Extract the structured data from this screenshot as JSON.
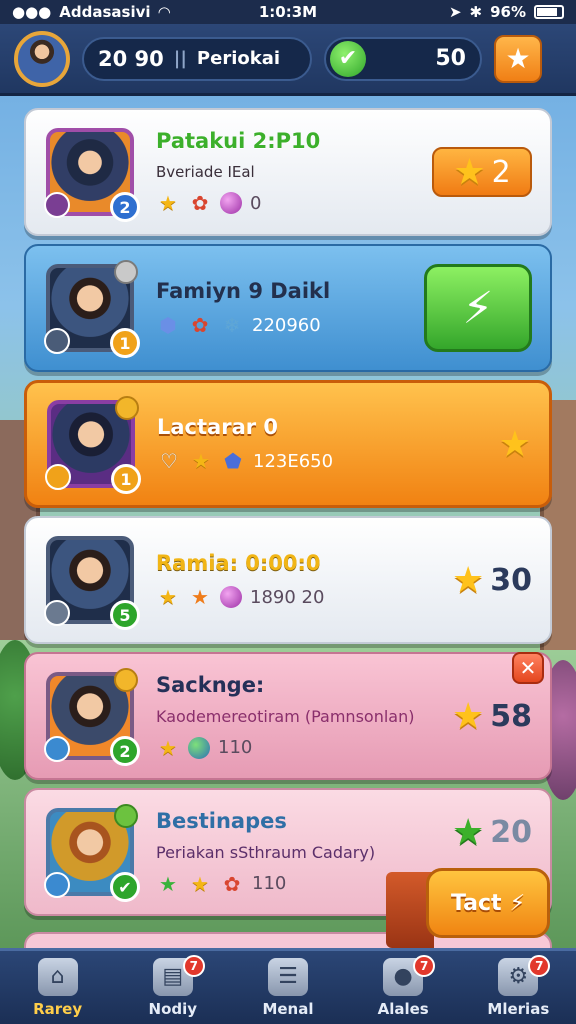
{
  "status_bar": {
    "carrier": "Addasasivi",
    "time": "1:0:3M",
    "battery": "96%"
  },
  "header": {
    "stat_value": "20 90",
    "player_name": "Periokai",
    "currency": "50"
  },
  "entries": [
    {
      "name": "Patakui 2:P10",
      "subtitle": "Bveriade IEal",
      "level": "2",
      "stats": "0",
      "score": "2",
      "accent": "#3cb02b"
    },
    {
      "name": "Famiyn 9 Daikl",
      "level": "1",
      "stats": "220960",
      "action_icon": "lightning-icon"
    },
    {
      "name": "Lactarar 0",
      "level": "1",
      "stats": "123E650"
    },
    {
      "name": "Ramia: 0:00:0",
      "level": "5",
      "stats": "1890 20",
      "score": "30"
    },
    {
      "name": "Sacknge:",
      "subtitle": "Kaodemereotiram (Pamnsonlan)",
      "level": "2",
      "stats": "110",
      "score": "58"
    },
    {
      "name": "Bestinapes",
      "subtitle": "Periakan sSthraum Cadary)",
      "stats": "110",
      "score": "20"
    }
  ],
  "action_button": {
    "label": "Tact"
  },
  "nav": [
    {
      "label": "Rarey",
      "icon": "home-icon",
      "badge": ""
    },
    {
      "label": "Nodiy",
      "icon": "inbox-icon",
      "badge": "7"
    },
    {
      "label": "Menal",
      "icon": "scroll-icon",
      "badge": ""
    },
    {
      "label": "Alales",
      "icon": "chat-icon",
      "badge": "7"
    },
    {
      "label": "Mlerias",
      "icon": "settings-icon",
      "badge": "7"
    }
  ]
}
